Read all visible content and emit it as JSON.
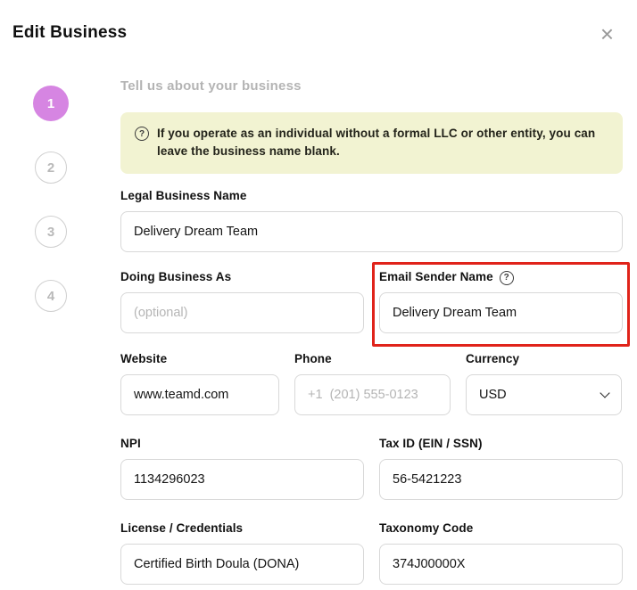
{
  "modal": {
    "title": "Edit Business",
    "close_icon": "×"
  },
  "steps": [
    {
      "number": "1",
      "active": true
    },
    {
      "number": "2",
      "active": false
    },
    {
      "number": "3",
      "active": false
    },
    {
      "number": "4",
      "active": false
    }
  ],
  "form": {
    "section_heading": "Tell us about your business",
    "info_box": {
      "icon": "?",
      "text": "If you operate as an individual without a formal LLC or other entity, you can leave the business name blank."
    },
    "fields": {
      "legal_business_name": {
        "label": "Legal Business Name",
        "value": "Delivery Dream Team"
      },
      "doing_business_as": {
        "label": "Doing Business As",
        "placeholder": "(optional)"
      },
      "email_sender_name": {
        "label": "Email Sender Name",
        "help_icon": "?",
        "value": "Delivery Dream Team"
      },
      "website": {
        "label": "Website",
        "value": "www.teamd.com"
      },
      "phone": {
        "label": "Phone",
        "placeholder": "+1  (201) 555-0123"
      },
      "currency": {
        "label": "Currency",
        "value": "USD"
      },
      "npi": {
        "label": "NPI",
        "value": "1134296023"
      },
      "tax_id": {
        "label": "Tax ID (EIN / SSN)",
        "value": "56-5421223"
      },
      "license": {
        "label": "License / Credentials",
        "value": "Certified Birth Doula (DONA)"
      },
      "taxonomy_code": {
        "label": "Taxonomy Code",
        "value": "374J00000X"
      }
    }
  },
  "colors": {
    "step_active": "#d685e2",
    "info_bg": "#f2f3d2",
    "annotation_red": "#e0231a"
  }
}
